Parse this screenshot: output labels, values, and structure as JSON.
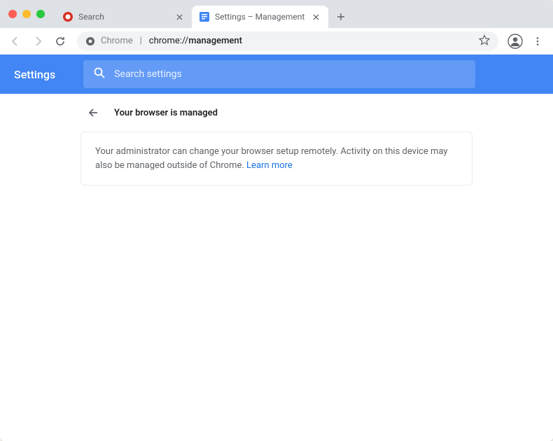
{
  "tabs": [
    {
      "title": "Search",
      "active": false
    },
    {
      "title": "Settings – Management",
      "active": true
    }
  ],
  "omnibox": {
    "scheme_label": "Chrome",
    "url_prefix": "chrome://",
    "url_path": "management"
  },
  "settings": {
    "title": "Settings",
    "search_placeholder": "Search settings",
    "panel_title": "Your browser is managed",
    "panel_body": "Your administrator can change your browser setup remotely. Activity on this device may also be managed outside of Chrome. ",
    "learn_more": "Learn more"
  }
}
